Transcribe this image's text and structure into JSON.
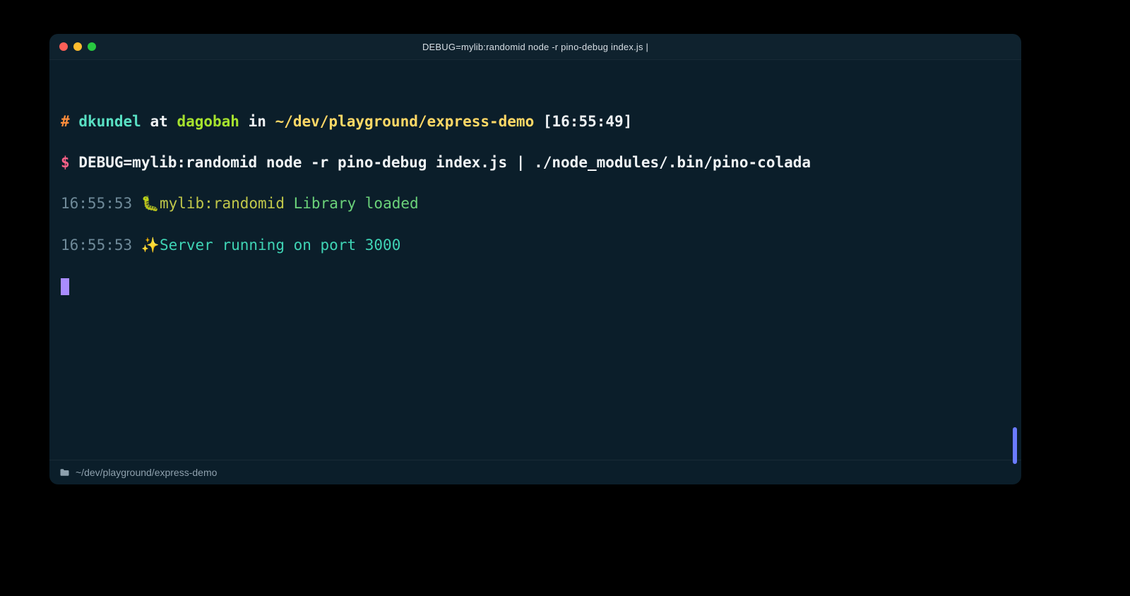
{
  "window": {
    "title": "DEBUG=mylib:randomid node -r pino-debug index.js |"
  },
  "prompt1": {
    "hash": "#",
    "user": "dkundel",
    "at": "at",
    "host": "dagobah",
    "in": "in",
    "path": "~/dev/playground/express-demo",
    "time": "[16:55:49]"
  },
  "prompt2": {
    "dollar": "$",
    "command": "DEBUG=mylib:randomid node -r pino-debug index.js | ./node_modules/.bin/pino-colada"
  },
  "log": [
    {
      "ts": "16:55:53",
      "icon": "🐛",
      "tag": "mylib:randomid",
      "msg": "Library loaded",
      "msgClass": "c-msg1"
    },
    {
      "ts": "16:55:53",
      "icon": "✨",
      "tag": "",
      "msg": "Server running on port 3000",
      "msgClass": "c-msg2"
    }
  ],
  "statusbar": {
    "cwd": "~/dev/playground/express-demo"
  }
}
